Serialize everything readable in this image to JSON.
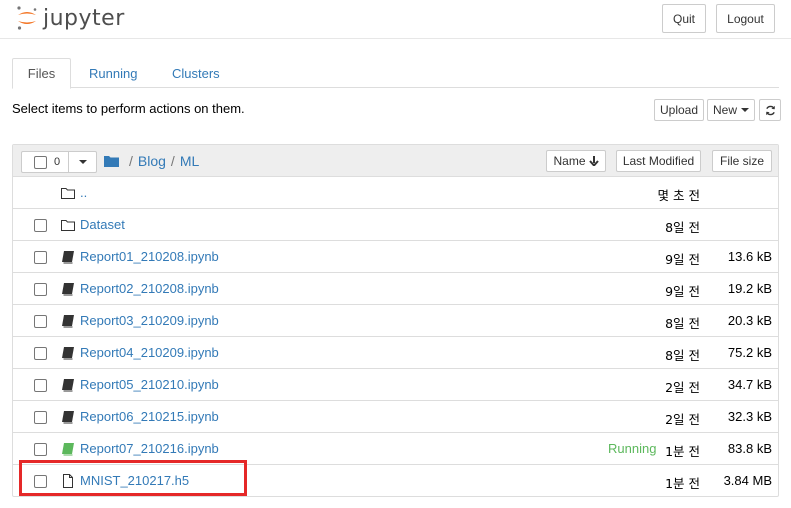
{
  "header": {
    "logo_text": "jupyter",
    "quit_label": "Quit",
    "logout_label": "Logout"
  },
  "tabs": [
    {
      "label": "Files",
      "active": true
    },
    {
      "label": "Running",
      "active": false
    },
    {
      "label": "Clusters",
      "active": false
    }
  ],
  "toolbar": {
    "select_message": "Select items to perform actions on them.",
    "upload_label": "Upload",
    "new_label": "New",
    "refresh_icon": "refresh-icon"
  },
  "list_header": {
    "selected_count": "0",
    "breadcrumbs": [
      "Blog",
      "ML"
    ],
    "sort_name_label": "Name",
    "last_modified_label": "Last Modified",
    "file_size_label": "File size"
  },
  "files": [
    {
      "name": "..",
      "type": "parent",
      "modified": "몇 초 전",
      "size": "",
      "status": ""
    },
    {
      "name": "Dataset",
      "type": "folder",
      "modified": "8일 전",
      "size": "",
      "status": ""
    },
    {
      "name": "Report01_210208.ipynb",
      "type": "notebook",
      "modified": "9일 전",
      "size": "13.6 kB",
      "status": ""
    },
    {
      "name": "Report02_210208.ipynb",
      "type": "notebook",
      "modified": "9일 전",
      "size": "19.2 kB",
      "status": ""
    },
    {
      "name": "Report03_210209.ipynb",
      "type": "notebook",
      "modified": "8일 전",
      "size": "20.3 kB",
      "status": ""
    },
    {
      "name": "Report04_210209.ipynb",
      "type": "notebook",
      "modified": "8일 전",
      "size": "75.2 kB",
      "status": ""
    },
    {
      "name": "Report05_210210.ipynb",
      "type": "notebook",
      "modified": "2일 전",
      "size": "34.7 kB",
      "status": ""
    },
    {
      "name": "Report06_210215.ipynb",
      "type": "notebook",
      "modified": "2일 전",
      "size": "32.3 kB",
      "status": ""
    },
    {
      "name": "Report07_210216.ipynb",
      "type": "notebook-running",
      "modified": "1분 전",
      "size": "83.8 kB",
      "status": "Running"
    },
    {
      "name": "MNIST_210217.h5",
      "type": "file",
      "modified": "1분 전",
      "size": "3.84 MB",
      "status": ""
    }
  ],
  "colors": {
    "link": "#337ab7",
    "running": "#5cb85c",
    "highlight": "#e52828",
    "logo_orange": "#f37626"
  }
}
